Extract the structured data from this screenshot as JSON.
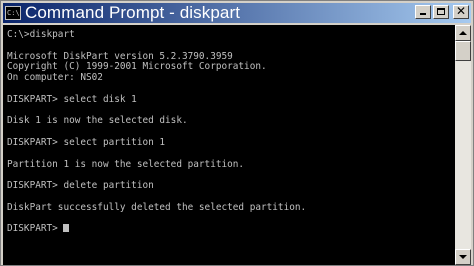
{
  "window": {
    "title": "Command Prompt - diskpart",
    "icon_label": "C:\\"
  },
  "console": {
    "lines": [
      "C:\\>diskpart",
      "",
      "Microsoft DiskPart version 5.2.3790.3959",
      "Copyright (C) 1999-2001 Microsoft Corporation.",
      "On computer: NS02",
      "",
      "DISKPART> select disk 1",
      "",
      "Disk 1 is now the selected disk.",
      "",
      "DISKPART> select partition 1",
      "",
      "Partition 1 is now the selected partition.",
      "",
      "DISKPART> delete partition",
      "",
      "DiskPart successfully deleted the selected partition.",
      "",
      "DISKPART> "
    ]
  },
  "colors": {
    "title_bar_start": "#0a246a",
    "title_bar_end": "#a6caf0",
    "console_bg": "#000000",
    "console_text": "#c0c0c0"
  },
  "icons": {
    "title": [
      "console-icon",
      "minimize-icon",
      "maximize-icon",
      "close-icon"
    ],
    "scrollbar": [
      "scroll-up-arrow-icon",
      "scroll-down-arrow-icon"
    ]
  }
}
